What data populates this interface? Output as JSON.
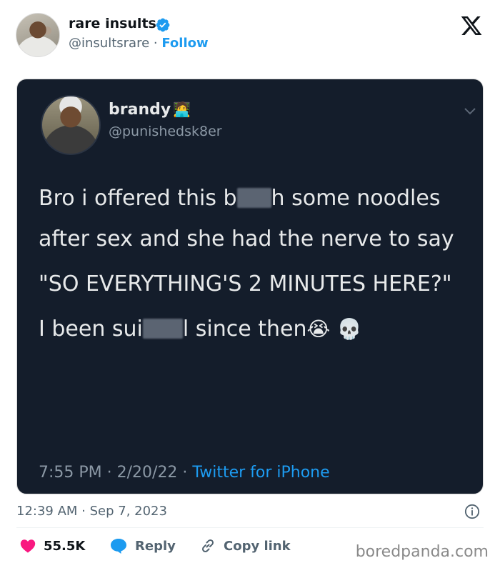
{
  "header": {
    "author_name": "rare insults",
    "handle": "@insultsrare",
    "separator": "·",
    "follow_label": "Follow"
  },
  "quoted": {
    "name": "brandy",
    "handle": "@punishedsk8er",
    "line1_a": "Bro i offered this b",
    "line1_b": "h some noodles after sex and she had the nerve to say",
    "line2": "\"SO EVERYTHING'S 2 MINUTES HERE?\"",
    "line3_a": "I been sui",
    "line3_b": "l since then",
    "emoji_cry": "😭",
    "emoji_skull": "💀",
    "emoji_name": "🧑‍💻",
    "timestamp": "7:55 PM · 2/20/22 · ",
    "source": "Twitter for iPhone"
  },
  "meta": {
    "date": "12:39 AM · Sep 7, 2023"
  },
  "actions": {
    "likes": "55.5K",
    "reply_label": "Reply",
    "copy_label": "Copy link"
  },
  "watermark": "boredpanda.com",
  "colors": {
    "accent": "#1d9bf0",
    "like": "#f91880",
    "card_bg": "#141d2b"
  }
}
